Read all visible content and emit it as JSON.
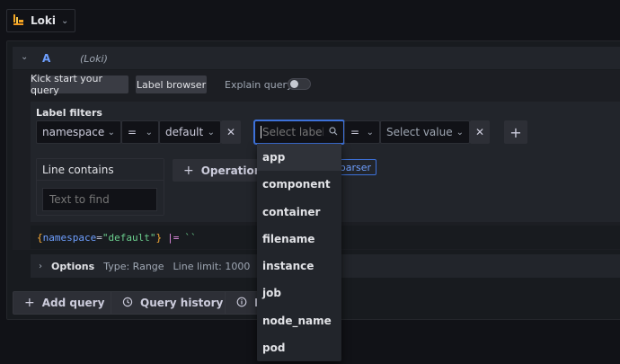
{
  "datasource": {
    "name": "Loki"
  },
  "query": {
    "ref_id": "A",
    "ds_tag": "(Loki)",
    "buttons": {
      "kick_start": "Kick start your query",
      "label_browser": "Label browser"
    },
    "explain_label": "Explain query",
    "label_filters": {
      "title": "Label filters",
      "filter1": {
        "label": "namespace",
        "op": "=",
        "value": "default"
      },
      "filter2": {
        "label_placeholder": "Select label",
        "op": "=",
        "value_placeholder": "Select value"
      }
    },
    "line_contains": {
      "title": "Line contains",
      "placeholder": "Text to find"
    },
    "operations_label": "Operations",
    "parser_hint": "parser",
    "code": {
      "open": "{",
      "key": "namespace",
      "eq": "=",
      "val": "\"default\"",
      "close": "}",
      "pipe": "|=",
      "str": "``"
    },
    "options": {
      "title": "Options",
      "type": "Type: Range",
      "limit": "Line limit: 1000"
    }
  },
  "bottom": {
    "add_query": "Add query",
    "history": "Query history",
    "inspector": "I"
  },
  "label_dropdown": [
    "app",
    "component",
    "container",
    "filename",
    "instance",
    "job",
    "node_name",
    "pod"
  ],
  "colors": {
    "accent": "#3d71d9",
    "brace": "#fbad37",
    "key": "#6e9fff",
    "string": "#6ccf8e"
  }
}
